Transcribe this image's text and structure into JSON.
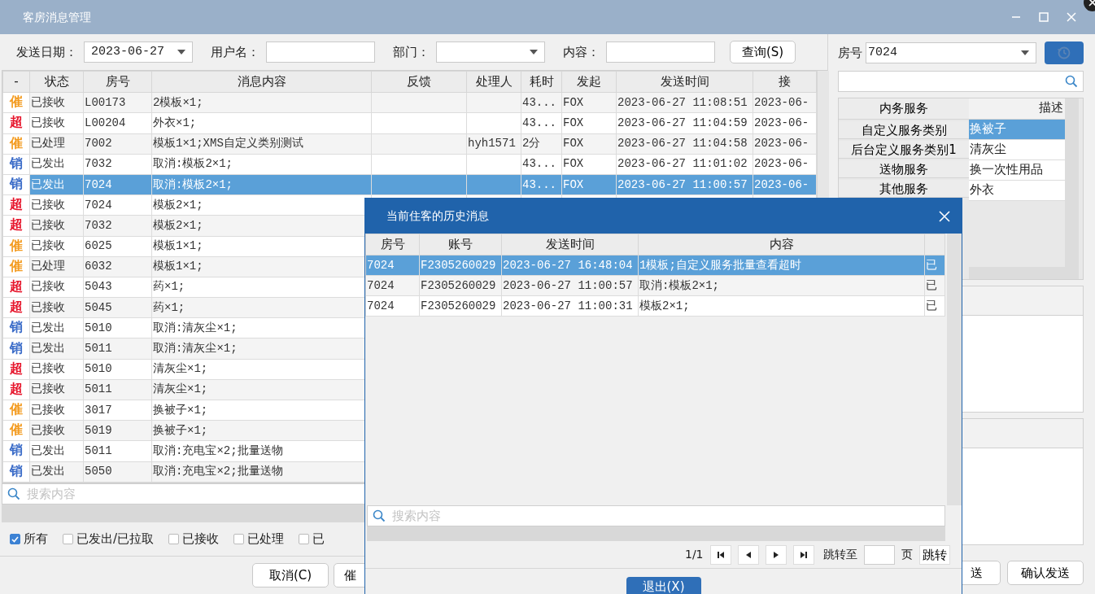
{
  "window": {
    "title": "客房消息管理"
  },
  "filters": [
    {
      "label": "发送日期：",
      "value": "2023-06-27",
      "kind": "dropdown"
    },
    {
      "label": "用户名：",
      "kind": "text"
    },
    {
      "label": "部门：",
      "kind": "dropdown"
    },
    {
      "label": "内容：",
      "kind": "text"
    }
  ],
  "query_button": "查询(S)",
  "main_table": {
    "tag_header": "-",
    "columns": [
      "状态",
      "房号",
      "消息内容",
      "反馈",
      "处理人",
      "耗时",
      "发起",
      "发送时间",
      "接"
    ],
    "rows": [
      {
        "tag": "催",
        "color": "#f39a1e",
        "cells": [
          "已接收",
          "L00173",
          "2模板×1;",
          null,
          null,
          "43...",
          "FOX",
          "2023-06-27 11:08:51",
          "2023-06-"
        ],
        "selected": false
      },
      {
        "tag": "超",
        "color": "#e6152b",
        "cells": [
          "已接收",
          "L00204",
          "外衣×1;",
          null,
          null,
          "43...",
          "FOX",
          "2023-06-27 11:04:59",
          "2023-06-"
        ],
        "selected": false
      },
      {
        "tag": "催",
        "color": "#f39a1e",
        "cells": [
          "已处理",
          "7002",
          "模板1×1;XMS自定义类别测试",
          null,
          "hyh1571",
          "2分",
          "FOX",
          "2023-06-27 11:04:58",
          "2023-06-"
        ],
        "selected": false
      },
      {
        "tag": "销",
        "color": "#3b6cc8",
        "cells": [
          "已发出",
          "7032",
          "取消:模板2×1;",
          null,
          null,
          "43...",
          "FOX",
          "2023-06-27 11:01:02",
          "2023-06-"
        ],
        "selected": false
      },
      {
        "tag": "销",
        "color": "#3b6cc8",
        "cells": [
          "已发出",
          "7024",
          "取消:模板2×1;",
          null,
          null,
          "43...",
          "FOX",
          "2023-06-27 11:00:57",
          "2023-06-"
        ],
        "selected": true
      },
      {
        "tag": "超",
        "color": "#e6152b",
        "cells": [
          "已接收",
          "7024",
          "模板2×1;"
        ],
        "selected": false
      },
      {
        "tag": "超",
        "color": "#e6152b",
        "cells": [
          "已接收",
          "7032",
          "模板2×1;"
        ],
        "selected": false
      },
      {
        "tag": "催",
        "color": "#f39a1e",
        "cells": [
          "已接收",
          "6025",
          "模板1×1;"
        ],
        "selected": false
      },
      {
        "tag": "催",
        "color": "#f39a1e",
        "cells": [
          "已处理",
          "6032",
          "模板1×1;"
        ],
        "selected": false
      },
      {
        "tag": "超",
        "color": "#e6152b",
        "cells": [
          "已接收",
          "5043",
          "药×1;"
        ],
        "selected": false
      },
      {
        "tag": "超",
        "color": "#e6152b",
        "cells": [
          "已接收",
          "5045",
          "药×1;"
        ],
        "selected": false
      },
      {
        "tag": "销",
        "color": "#3b6cc8",
        "cells": [
          "已发出",
          "5010",
          "取消:清灰尘×1;"
        ],
        "selected": false
      },
      {
        "tag": "销",
        "color": "#3b6cc8",
        "cells": [
          "已发出",
          "5011",
          "取消:清灰尘×1;"
        ],
        "selected": false
      },
      {
        "tag": "超",
        "color": "#e6152b",
        "cells": [
          "已接收",
          "5010",
          "清灰尘×1;"
        ],
        "selected": false
      },
      {
        "tag": "超",
        "color": "#e6152b",
        "cells": [
          "已接收",
          "5011",
          "清灰尘×1;"
        ],
        "selected": false
      },
      {
        "tag": "催",
        "color": "#f39a1e",
        "cells": [
          "已接收",
          "3017",
          "换被子×1;"
        ],
        "selected": false
      },
      {
        "tag": "催",
        "color": "#f39a1e",
        "cells": [
          "已接收",
          "5019",
          "换被子×1;"
        ],
        "selected": false
      },
      {
        "tag": "销",
        "color": "#3b6cc8",
        "cells": [
          "已发出",
          "5011",
          "取消:充电宝×2;批量送物"
        ],
        "selected": false
      },
      {
        "tag": "销",
        "color": "#3b6cc8",
        "cells": [
          "已发出",
          "5050",
          "取消:充电宝×2;批量送物"
        ],
        "selected": false
      }
    ]
  },
  "search": {
    "placeholder": "搜索内容"
  },
  "status_filters": [
    {
      "label": "所有",
      "checked": true
    },
    {
      "label": "已发出/已拉取",
      "checked": false
    },
    {
      "label": "已接收",
      "checked": false
    },
    {
      "label": "已处理",
      "checked": false
    },
    {
      "label": "已",
      "checked": false
    }
  ],
  "bottom_buttons_left": [
    "取消(C)",
    "催"
  ],
  "bottom_buttons_right": [
    "送",
    "确认发送"
  ],
  "right_panel": {
    "room_label": "房号",
    "room_value": "7024",
    "categories": [
      {
        "label": "内务服务",
        "selected": false
      },
      {
        "label": "自定义服务类别",
        "selected": false
      },
      {
        "label": "后台定义服务类别1",
        "selected": false
      },
      {
        "label": "送物服务",
        "selected": false
      },
      {
        "label": "其他服务",
        "selected": false
      }
    ],
    "items_header": "描述",
    "items": [
      {
        "label": "换被子",
        "selected": true
      },
      {
        "label": "清灰尘",
        "selected": false
      },
      {
        "label": "换一次性用品",
        "selected": false
      },
      {
        "label": "外衣",
        "selected": false
      }
    ]
  },
  "dialog": {
    "title": "当前住客的历史消息",
    "columns": [
      "房号",
      "账号",
      "发送时间",
      "内容"
    ],
    "rows": [
      {
        "cells": [
          "7024",
          "F2305260029",
          "2023-06-27 16:48:04",
          "1模板;自定义服务批量查看超时",
          "已"
        ],
        "selected": true
      },
      {
        "cells": [
          "7024",
          "F2305260029",
          "2023-06-27 11:00:57",
          "取消:模板2×1;",
          "已"
        ],
        "selected": false
      },
      {
        "cells": [
          "7024",
          "F2305260029",
          "2023-06-27 11:00:31",
          "模板2×1;",
          "已"
        ],
        "selected": false
      }
    ],
    "search": {
      "placeholder": "搜索内容"
    },
    "page": "1/1",
    "goto_label": "跳转至",
    "page_unit": "页",
    "goto_button": "跳转",
    "exit_button": "退出(X)"
  }
}
